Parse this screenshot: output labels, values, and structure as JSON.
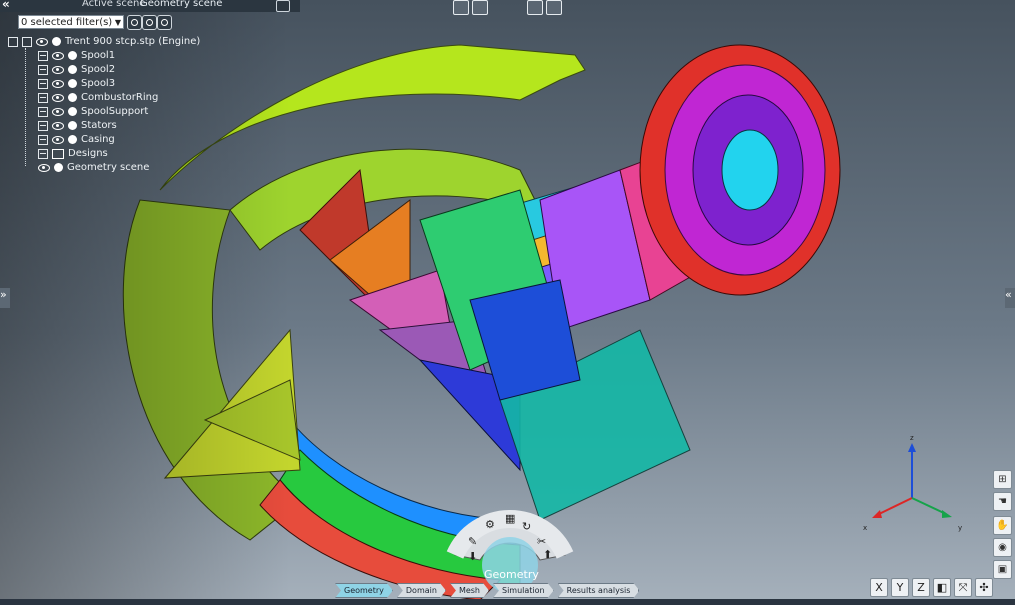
{
  "header": {
    "collapse_icon": "double-chevron-left-icon",
    "active_scene_label": "Active scene",
    "active_scene_value": "Geometry scene"
  },
  "toolbar_top": {
    "items": [
      "save-icon",
      "undo-icon",
      "redo-icon",
      "save-as-icon"
    ]
  },
  "filter": {
    "value": "0 selected filter(s)"
  },
  "tree": {
    "root": "Trent 900 stcp.stp (Engine)",
    "items": [
      "Spool1",
      "Spool2",
      "Spool3",
      "CombustorRing",
      "SpoolSupport",
      "Stators",
      "Casing"
    ],
    "designs": "Designs",
    "geometry_scene": "Geometry scene"
  },
  "radial_menu": {
    "label": "Geometry"
  },
  "workflow": {
    "steps": [
      "Geometry",
      "Domain",
      "Mesh",
      "Simulation",
      "Results analysis"
    ],
    "active": "Geometry"
  },
  "axes": {
    "x": "X",
    "y": "Y",
    "z": "Z"
  },
  "side_panels": {
    "left": "»",
    "right": "«"
  },
  "colors": {
    "background_top": "#46525e",
    "background_bottom": "#a6b1bc",
    "active_step": "#8fd3e6"
  }
}
